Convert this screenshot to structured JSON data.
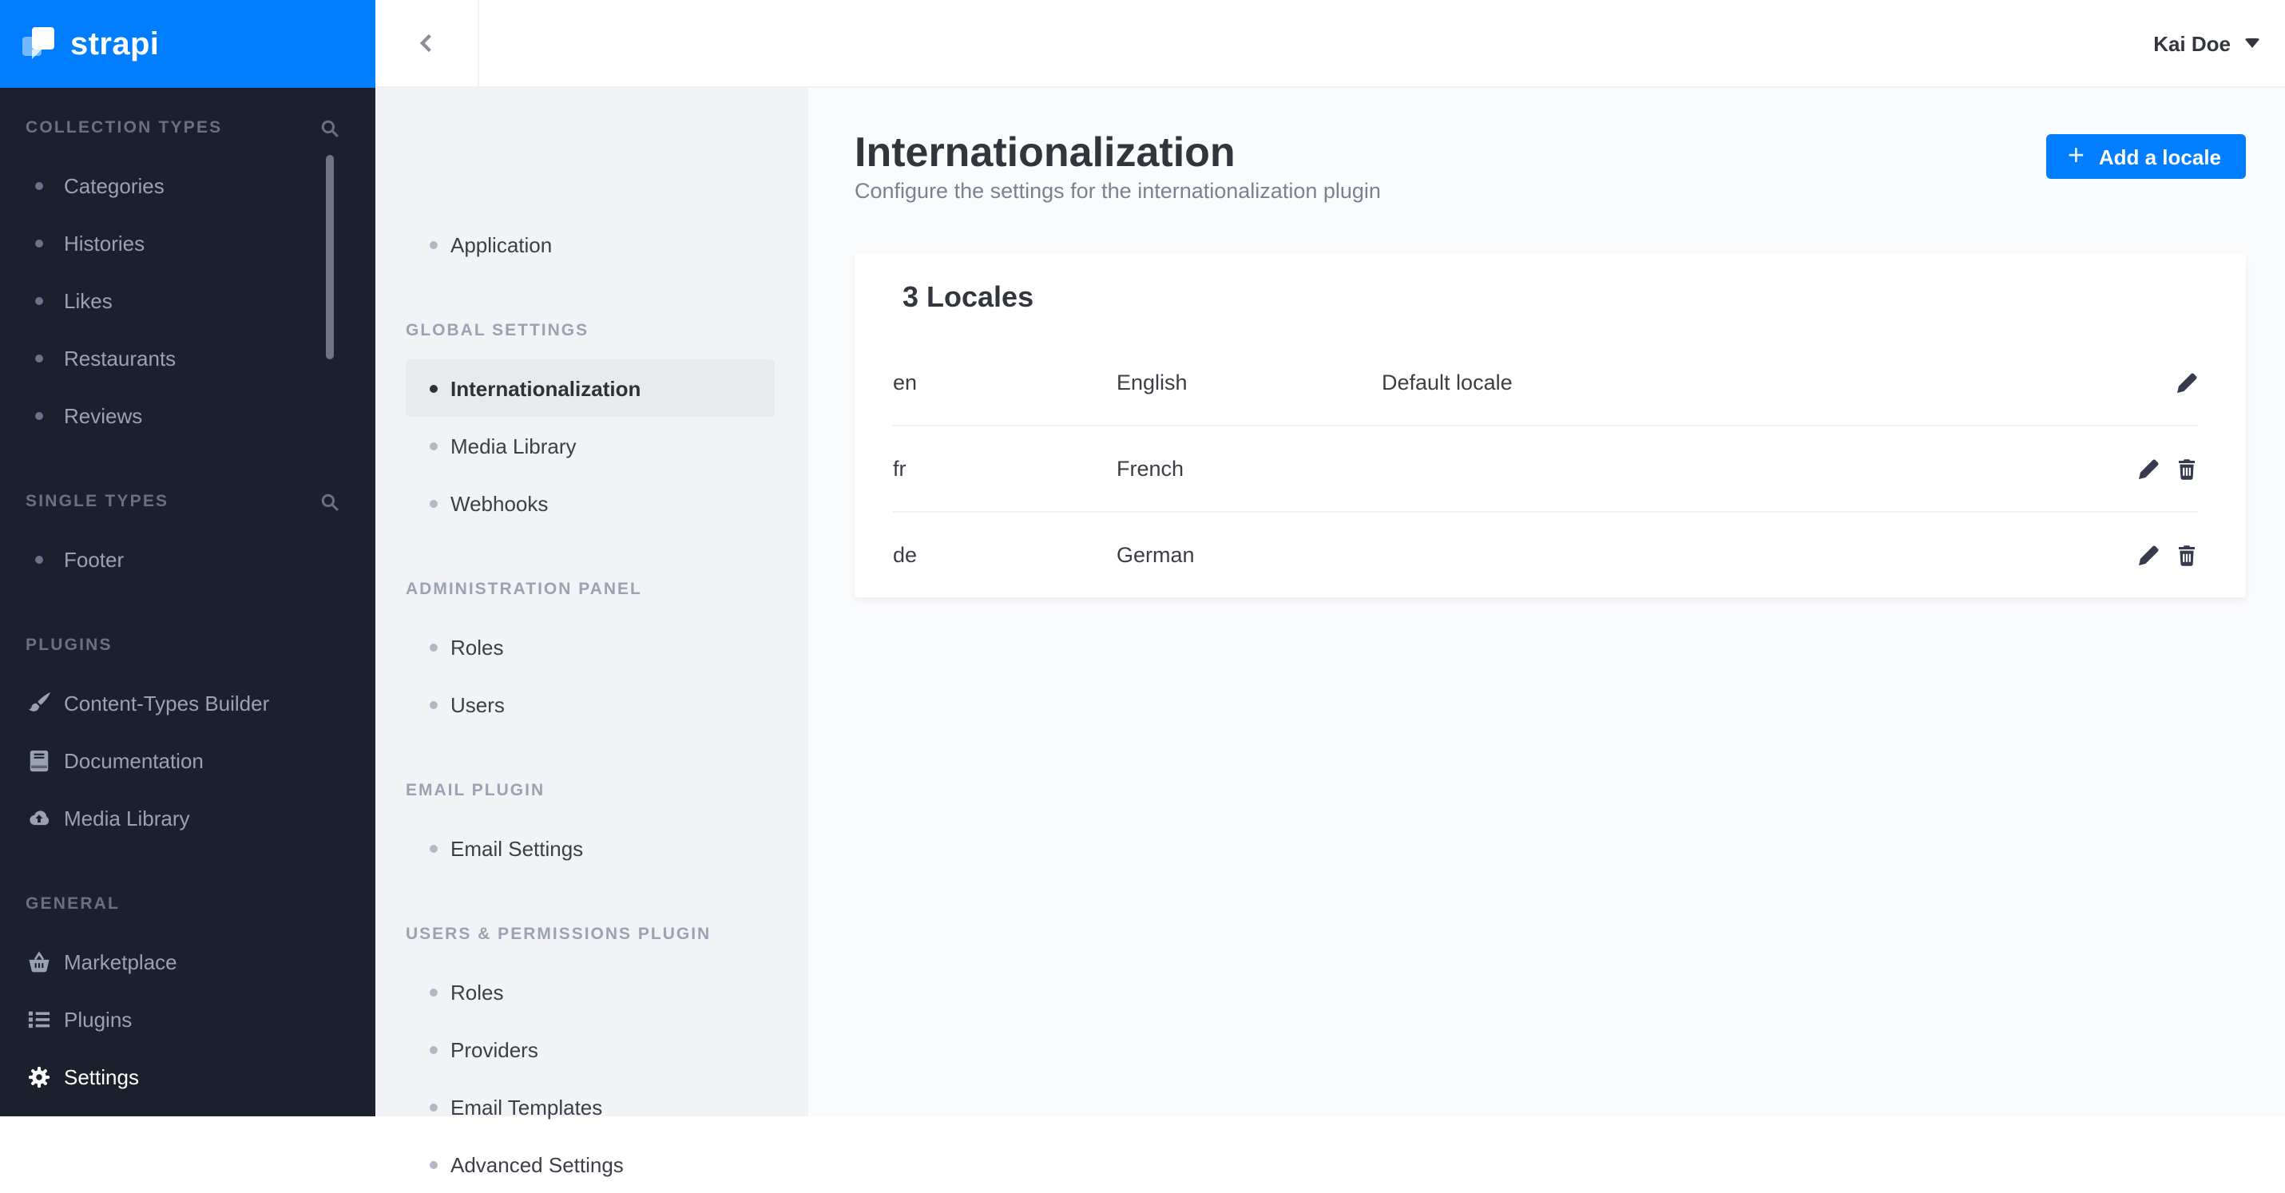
{
  "brand": {
    "wordmark": "strapi",
    "logo_bg": "#007eff"
  },
  "topbar": {
    "user_name": "Kai Doe"
  },
  "left_sidebar": {
    "sections": [
      {
        "label": "COLLECTION TYPES",
        "has_search": true,
        "items": [
          "Categories",
          "Histories",
          "Likes",
          "Restaurants",
          "Reviews"
        ]
      },
      {
        "label": "SINGLE TYPES",
        "has_search": true,
        "items": [
          "Footer"
        ]
      },
      {
        "label": "PLUGINS",
        "has_search": false,
        "items": [
          "Content-Types Builder",
          "Documentation",
          "Media Library"
        ],
        "icons": [
          "brush-icon",
          "book-icon",
          "cloud-upload-icon"
        ]
      },
      {
        "label": "GENERAL",
        "has_search": false,
        "items": [
          "Marketplace",
          "Plugins",
          "Settings"
        ],
        "icons": [
          "basket-icon",
          "list-icon",
          "gear-icon"
        ],
        "active_item": "Settings"
      }
    ]
  },
  "settings_nav": {
    "top_items": [
      "Application"
    ],
    "sections": [
      {
        "label": "GLOBAL SETTINGS",
        "items": [
          "Internationalization",
          "Media Library",
          "Webhooks"
        ],
        "active_item": "Internationalization"
      },
      {
        "label": "ADMINISTRATION PANEL",
        "items": [
          "Roles",
          "Users"
        ]
      },
      {
        "label": "EMAIL PLUGIN",
        "items": [
          "Email Settings"
        ]
      },
      {
        "label": "USERS & PERMISSIONS PLUGIN",
        "items": [
          "Roles",
          "Providers",
          "Email Templates",
          "Advanced Settings"
        ]
      }
    ]
  },
  "main": {
    "title": "Internationalization",
    "subtitle": "Configure the settings for the internationalization plugin",
    "add_button_label": "Add a locale",
    "locales_card": {
      "heading": "3 Locales",
      "rows": [
        {
          "code": "en",
          "name": "English",
          "note": "Default locale"
        },
        {
          "code": "fr",
          "name": "French",
          "note": ""
        },
        {
          "code": "de",
          "name": "German",
          "note": ""
        }
      ]
    }
  },
  "colors": {
    "accent": "#007eff",
    "sidebar_bg": "#1b212c",
    "subnav_bg": "#f2f3f6",
    "main_bg": "#fafbfd"
  }
}
